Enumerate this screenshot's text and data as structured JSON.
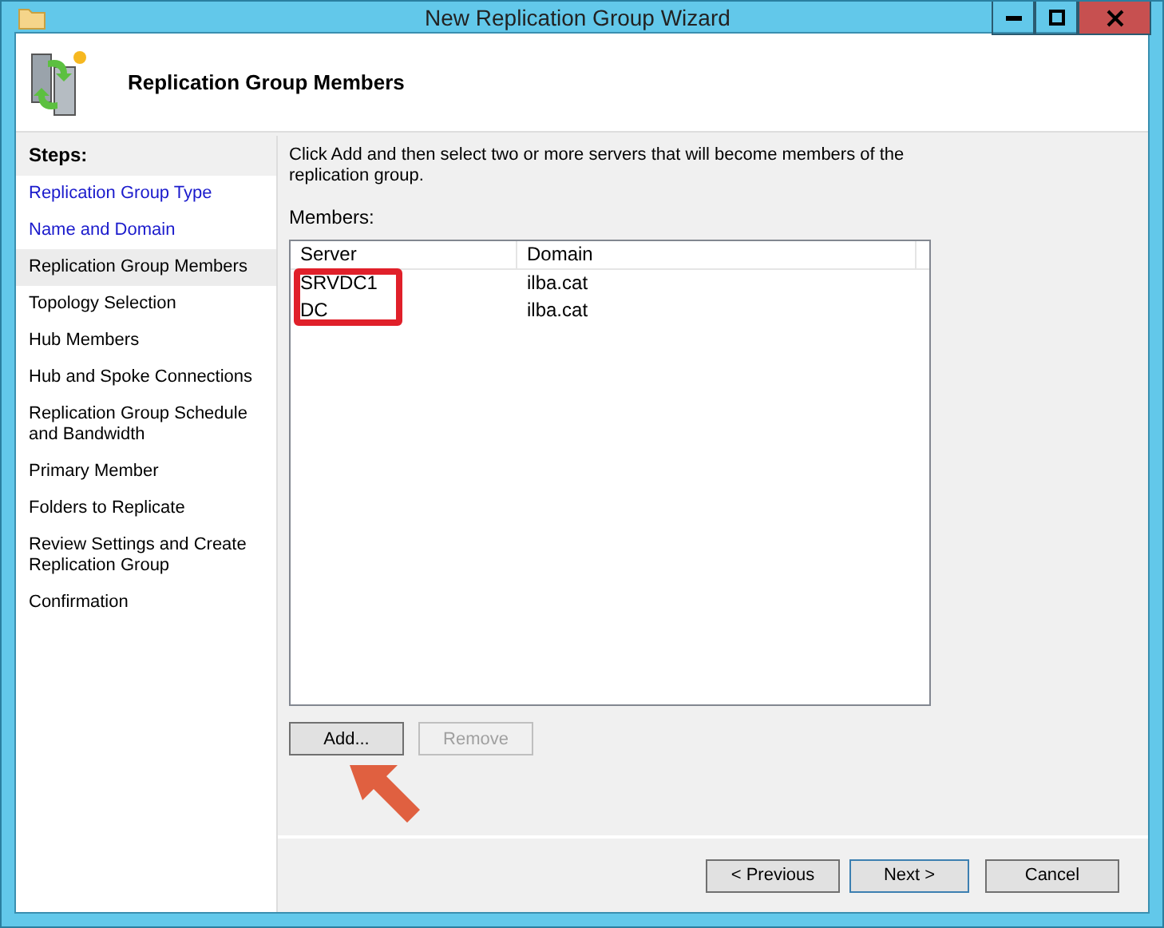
{
  "window": {
    "title": "New Replication Group Wizard"
  },
  "header": {
    "title": "Replication Group Members"
  },
  "steps": {
    "heading": "Steps:",
    "items": [
      {
        "label": "Replication Group Type",
        "visited": true,
        "selected": false
      },
      {
        "label": "Name and Domain",
        "visited": true,
        "selected": false
      },
      {
        "label": "Replication Group Members",
        "visited": false,
        "selected": true
      },
      {
        "label": "Topology Selection",
        "visited": false,
        "selected": false
      },
      {
        "label": "Hub Members",
        "visited": false,
        "selected": false
      },
      {
        "label": "Hub and Spoke Connections",
        "visited": false,
        "selected": false
      },
      {
        "label": "Replication Group Schedule and Bandwidth",
        "visited": false,
        "selected": false
      },
      {
        "label": "Primary Member",
        "visited": false,
        "selected": false
      },
      {
        "label": "Folders to Replicate",
        "visited": false,
        "selected": false
      },
      {
        "label": "Review Settings and Create Replication Group",
        "visited": false,
        "selected": false
      },
      {
        "label": "Confirmation",
        "visited": false,
        "selected": false
      }
    ]
  },
  "instructions": "Click Add and then select two or more servers that will become members of the replication group.",
  "members": {
    "label": "Members:",
    "columns": [
      "Server",
      "Domain"
    ],
    "rows": [
      {
        "server": "SRVDC1",
        "domain": "ilba.cat"
      },
      {
        "server": "DC",
        "domain": "ilba.cat"
      }
    ]
  },
  "list_buttons": [
    {
      "label": "Add...",
      "disabled": false
    },
    {
      "label": "Remove",
      "disabled": true
    }
  ],
  "nav_buttons": [
    {
      "label": "< Previous",
      "default": false
    },
    {
      "label": "Next >",
      "default": true
    },
    {
      "label": "Cancel",
      "default": false
    }
  ]
}
